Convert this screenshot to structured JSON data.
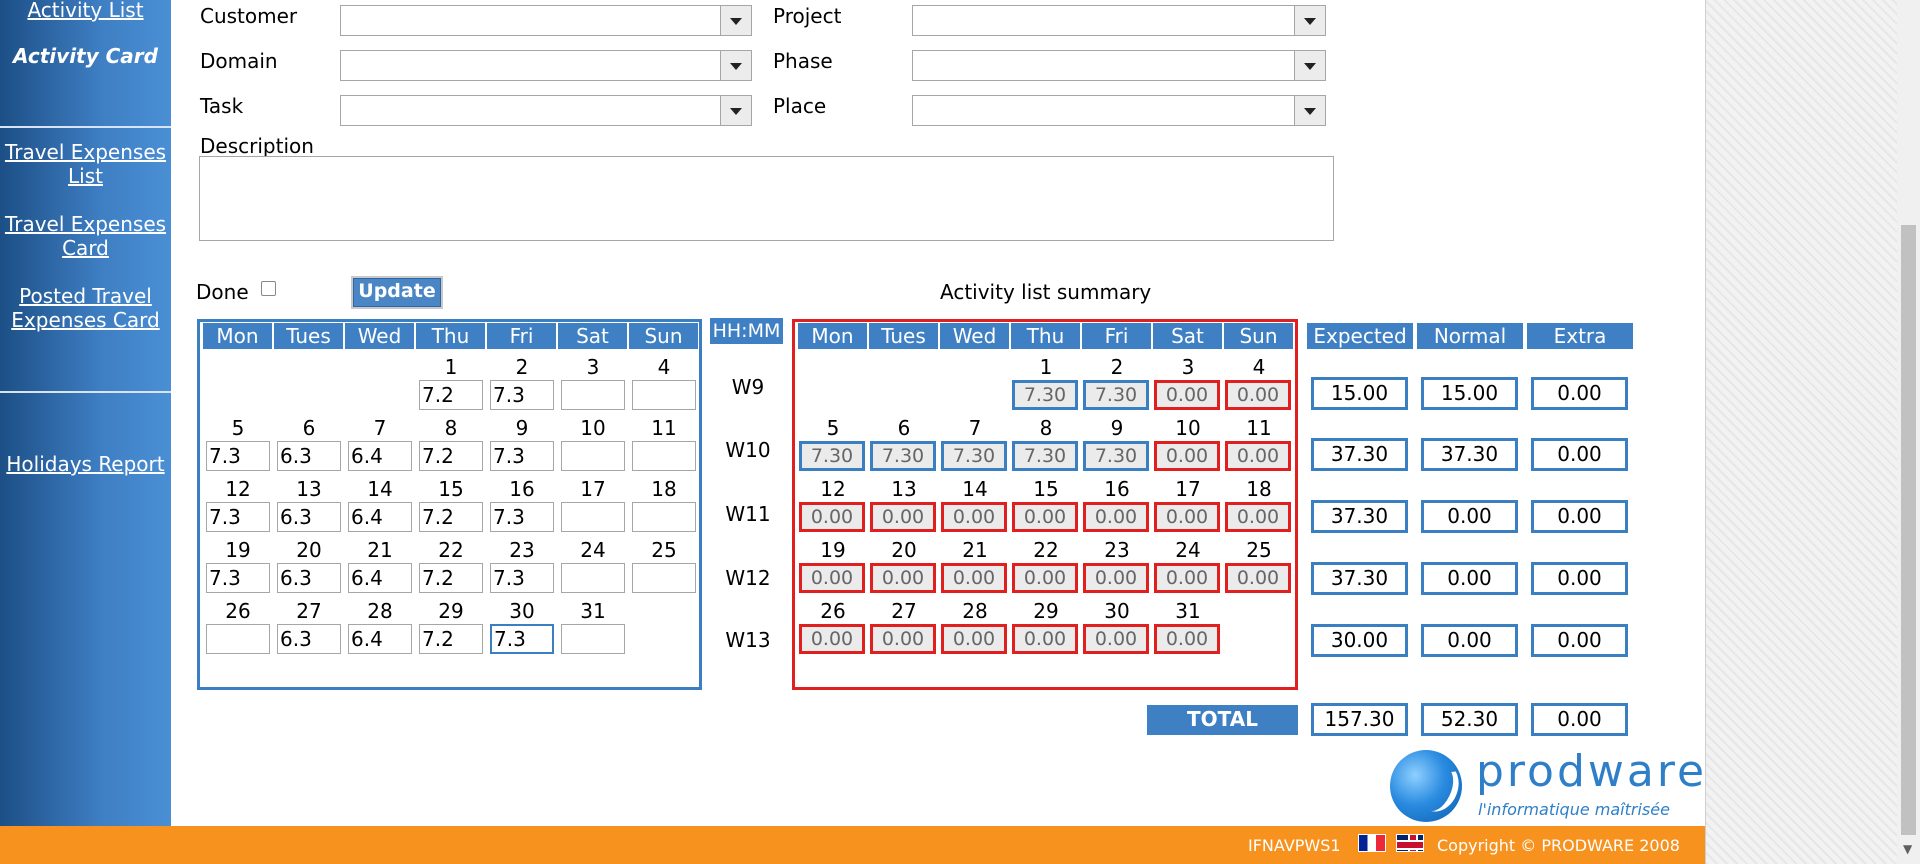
{
  "sidebar": {
    "activity_list": "Activity List",
    "activity_card": "Activity Card",
    "travel_list_1": "Travel Expenses",
    "travel_list_2": "List",
    "travel_card_1": "Travel Expenses",
    "travel_card_2": "Card",
    "posted_1": "Posted Travel",
    "posted_2": "Expenses Card",
    "holidays": "Holidays Report"
  },
  "form": {
    "customer_label": "Customer",
    "project_label": "Project",
    "domain_label": "Domain",
    "phase_label": "Phase",
    "task_label": "Task",
    "place_label": "Place",
    "description_label": "Description",
    "done_label": "Done",
    "update_button": "Update"
  },
  "summary_title": "Activity list summary",
  "day_headers": [
    "Mon",
    "Tues",
    "Wed",
    "Thu",
    "Fri",
    "Sat",
    "Sun"
  ],
  "hhmm_label": "HH:MM",
  "weeks": [
    "W9",
    "W10",
    "W11",
    "W12",
    "W13"
  ],
  "entry_rows": [
    {
      "days": [
        "",
        "",
        "",
        "1",
        "2",
        "3",
        "4"
      ],
      "values": [
        null,
        null,
        null,
        "7.2",
        "7.3",
        "",
        ""
      ]
    },
    {
      "days": [
        "5",
        "6",
        "7",
        "8",
        "9",
        "10",
        "11"
      ],
      "values": [
        "7.3",
        "6.3",
        "6.4",
        "7.2",
        "7.3",
        "",
        ""
      ]
    },
    {
      "days": [
        "12",
        "13",
        "14",
        "15",
        "16",
        "17",
        "18"
      ],
      "values": [
        "7.3",
        "6.3",
        "6.4",
        "7.2",
        "7.3",
        "",
        ""
      ]
    },
    {
      "days": [
        "19",
        "20",
        "21",
        "22",
        "23",
        "24",
        "25"
      ],
      "values": [
        "7.3",
        "6.3",
        "6.4",
        "7.2",
        "7.3",
        "",
        ""
      ]
    },
    {
      "days": [
        "26",
        "27",
        "28",
        "29",
        "30",
        "31",
        ""
      ],
      "values": [
        "",
        "6.3",
        "6.4",
        "7.2",
        "7.3",
        "",
        null
      ]
    }
  ],
  "summary_rows": [
    {
      "days": [
        "",
        "",
        "",
        "1",
        "2",
        "3",
        "4"
      ],
      "values": [
        null,
        null,
        null,
        "7.30",
        "7.30",
        "0.00",
        "0.00"
      ],
      "status": [
        null,
        null,
        null,
        "ok",
        "ok",
        "warn",
        "warn"
      ]
    },
    {
      "days": [
        "5",
        "6",
        "7",
        "8",
        "9",
        "10",
        "11"
      ],
      "values": [
        "7.30",
        "7.30",
        "7.30",
        "7.30",
        "7.30",
        "0.00",
        "0.00"
      ],
      "status": [
        "ok",
        "ok",
        "ok",
        "ok",
        "ok",
        "warn",
        "warn"
      ]
    },
    {
      "days": [
        "12",
        "13",
        "14",
        "15",
        "16",
        "17",
        "18"
      ],
      "values": [
        "0.00",
        "0.00",
        "0.00",
        "0.00",
        "0.00",
        "0.00",
        "0.00"
      ],
      "status": [
        "warn",
        "warn",
        "warn",
        "warn",
        "warn",
        "warn",
        "warn"
      ]
    },
    {
      "days": [
        "19",
        "20",
        "21",
        "22",
        "23",
        "24",
        "25"
      ],
      "values": [
        "0.00",
        "0.00",
        "0.00",
        "0.00",
        "0.00",
        "0.00",
        "0.00"
      ],
      "status": [
        "warn",
        "warn",
        "warn",
        "warn",
        "warn",
        "warn",
        "warn"
      ]
    },
    {
      "days": [
        "26",
        "27",
        "28",
        "29",
        "30",
        "31",
        ""
      ],
      "values": [
        "0.00",
        "0.00",
        "0.00",
        "0.00",
        "0.00",
        "0.00",
        null
      ],
      "status": [
        "warn",
        "warn",
        "warn",
        "warn",
        "warn",
        "warn",
        null
      ]
    }
  ],
  "totals": {
    "headers": [
      "Expected",
      "Normal",
      "Extra"
    ],
    "rows": [
      [
        "15.00",
        "15.00",
        "0.00"
      ],
      [
        "37.30",
        "37.30",
        "0.00"
      ],
      [
        "37.30",
        "0.00",
        "0.00"
      ],
      [
        "37.30",
        "0.00",
        "0.00"
      ],
      [
        "30.00",
        "0.00",
        "0.00"
      ]
    ],
    "total_label": "TOTAL",
    "grand": [
      "157.30",
      "52.30",
      "0.00"
    ]
  },
  "logo": {
    "name": "prodware",
    "tagline": "l'informatique maîtrisée"
  },
  "footer": {
    "server": "IFNAVPWS1",
    "copyright": "Copyright © PRODWARE 2008"
  },
  "colors": {
    "accent_blue": "#3e80c3",
    "alert_red": "#e0201f",
    "footer_orange": "#f7921e"
  }
}
